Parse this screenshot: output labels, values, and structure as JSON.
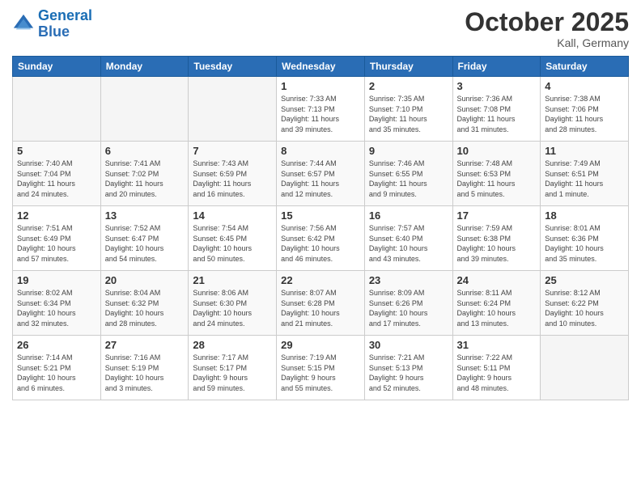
{
  "header": {
    "logo_line1": "General",
    "logo_line2": "Blue",
    "month": "October 2025",
    "location": "Kall, Germany"
  },
  "weekdays": [
    "Sunday",
    "Monday",
    "Tuesday",
    "Wednesday",
    "Thursday",
    "Friday",
    "Saturday"
  ],
  "weeks": [
    [
      {
        "day": "",
        "info": ""
      },
      {
        "day": "",
        "info": ""
      },
      {
        "day": "",
        "info": ""
      },
      {
        "day": "1",
        "info": "Sunrise: 7:33 AM\nSunset: 7:13 PM\nDaylight: 11 hours\nand 39 minutes."
      },
      {
        "day": "2",
        "info": "Sunrise: 7:35 AM\nSunset: 7:10 PM\nDaylight: 11 hours\nand 35 minutes."
      },
      {
        "day": "3",
        "info": "Sunrise: 7:36 AM\nSunset: 7:08 PM\nDaylight: 11 hours\nand 31 minutes."
      },
      {
        "day": "4",
        "info": "Sunrise: 7:38 AM\nSunset: 7:06 PM\nDaylight: 11 hours\nand 28 minutes."
      }
    ],
    [
      {
        "day": "5",
        "info": "Sunrise: 7:40 AM\nSunset: 7:04 PM\nDaylight: 11 hours\nand 24 minutes."
      },
      {
        "day": "6",
        "info": "Sunrise: 7:41 AM\nSunset: 7:02 PM\nDaylight: 11 hours\nand 20 minutes."
      },
      {
        "day": "7",
        "info": "Sunrise: 7:43 AM\nSunset: 6:59 PM\nDaylight: 11 hours\nand 16 minutes."
      },
      {
        "day": "8",
        "info": "Sunrise: 7:44 AM\nSunset: 6:57 PM\nDaylight: 11 hours\nand 12 minutes."
      },
      {
        "day": "9",
        "info": "Sunrise: 7:46 AM\nSunset: 6:55 PM\nDaylight: 11 hours\nand 9 minutes."
      },
      {
        "day": "10",
        "info": "Sunrise: 7:48 AM\nSunset: 6:53 PM\nDaylight: 11 hours\nand 5 minutes."
      },
      {
        "day": "11",
        "info": "Sunrise: 7:49 AM\nSunset: 6:51 PM\nDaylight: 11 hours\nand 1 minute."
      }
    ],
    [
      {
        "day": "12",
        "info": "Sunrise: 7:51 AM\nSunset: 6:49 PM\nDaylight: 10 hours\nand 57 minutes."
      },
      {
        "day": "13",
        "info": "Sunrise: 7:52 AM\nSunset: 6:47 PM\nDaylight: 10 hours\nand 54 minutes."
      },
      {
        "day": "14",
        "info": "Sunrise: 7:54 AM\nSunset: 6:45 PM\nDaylight: 10 hours\nand 50 minutes."
      },
      {
        "day": "15",
        "info": "Sunrise: 7:56 AM\nSunset: 6:42 PM\nDaylight: 10 hours\nand 46 minutes."
      },
      {
        "day": "16",
        "info": "Sunrise: 7:57 AM\nSunset: 6:40 PM\nDaylight: 10 hours\nand 43 minutes."
      },
      {
        "day": "17",
        "info": "Sunrise: 7:59 AM\nSunset: 6:38 PM\nDaylight: 10 hours\nand 39 minutes."
      },
      {
        "day": "18",
        "info": "Sunrise: 8:01 AM\nSunset: 6:36 PM\nDaylight: 10 hours\nand 35 minutes."
      }
    ],
    [
      {
        "day": "19",
        "info": "Sunrise: 8:02 AM\nSunset: 6:34 PM\nDaylight: 10 hours\nand 32 minutes."
      },
      {
        "day": "20",
        "info": "Sunrise: 8:04 AM\nSunset: 6:32 PM\nDaylight: 10 hours\nand 28 minutes."
      },
      {
        "day": "21",
        "info": "Sunrise: 8:06 AM\nSunset: 6:30 PM\nDaylight: 10 hours\nand 24 minutes."
      },
      {
        "day": "22",
        "info": "Sunrise: 8:07 AM\nSunset: 6:28 PM\nDaylight: 10 hours\nand 21 minutes."
      },
      {
        "day": "23",
        "info": "Sunrise: 8:09 AM\nSunset: 6:26 PM\nDaylight: 10 hours\nand 17 minutes."
      },
      {
        "day": "24",
        "info": "Sunrise: 8:11 AM\nSunset: 6:24 PM\nDaylight: 10 hours\nand 13 minutes."
      },
      {
        "day": "25",
        "info": "Sunrise: 8:12 AM\nSunset: 6:22 PM\nDaylight: 10 hours\nand 10 minutes."
      }
    ],
    [
      {
        "day": "26",
        "info": "Sunrise: 7:14 AM\nSunset: 5:21 PM\nDaylight: 10 hours\nand 6 minutes."
      },
      {
        "day": "27",
        "info": "Sunrise: 7:16 AM\nSunset: 5:19 PM\nDaylight: 10 hours\nand 3 minutes."
      },
      {
        "day": "28",
        "info": "Sunrise: 7:17 AM\nSunset: 5:17 PM\nDaylight: 9 hours\nand 59 minutes."
      },
      {
        "day": "29",
        "info": "Sunrise: 7:19 AM\nSunset: 5:15 PM\nDaylight: 9 hours\nand 55 minutes."
      },
      {
        "day": "30",
        "info": "Sunrise: 7:21 AM\nSunset: 5:13 PM\nDaylight: 9 hours\nand 52 minutes."
      },
      {
        "day": "31",
        "info": "Sunrise: 7:22 AM\nSunset: 5:11 PM\nDaylight: 9 hours\nand 48 minutes."
      },
      {
        "day": "",
        "info": ""
      }
    ]
  ]
}
